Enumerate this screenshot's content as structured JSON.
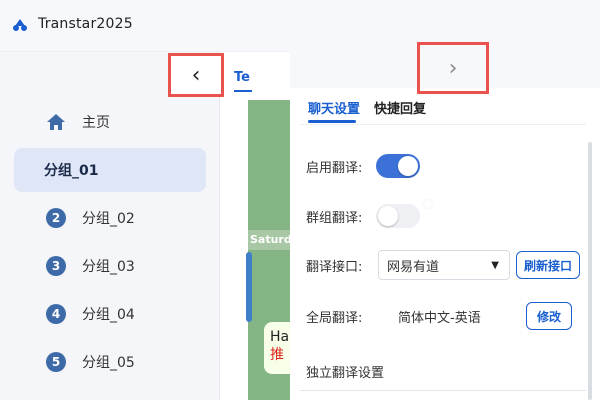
{
  "app": {
    "title": "Transtar2025",
    "logo_color": "#1a5fd0"
  },
  "sidebar": {
    "collapse_icon": "‹",
    "items": [
      {
        "label": "主页",
        "icon": "home-icon"
      },
      {
        "label": "分组_01",
        "active": true
      },
      {
        "label": "分组_02",
        "badge": "2"
      },
      {
        "label": "分组_03",
        "badge": "3"
      },
      {
        "label": "分组_04",
        "badge": "4"
      },
      {
        "label": "分组_05",
        "badge": "5"
      }
    ]
  },
  "chat": {
    "tab_label": "Te",
    "date_label": "Saturd",
    "bubble_line1": "Ha",
    "bubble_line2": "推"
  },
  "panel": {
    "expand_icon": "›",
    "tabs": [
      {
        "label": "聊天设置",
        "active": true
      },
      {
        "label": "快捷回复"
      }
    ],
    "enable_translate_label": "启用翻译:",
    "enable_translate_on": true,
    "group_translate_label": "群组翻译:",
    "group_translate_on": false,
    "api_label": "翻译接口:",
    "api_value": "网易有道",
    "refresh_button": "刷新接口",
    "global_label": "全局翻译:",
    "global_value": "简体中文-英语",
    "edit_button": "修改",
    "section_title": "独立翻译设置"
  },
  "colors": {
    "accent": "#1a5fd0",
    "highlight": "#e9524d",
    "chat_bg": "#86b585"
  }
}
